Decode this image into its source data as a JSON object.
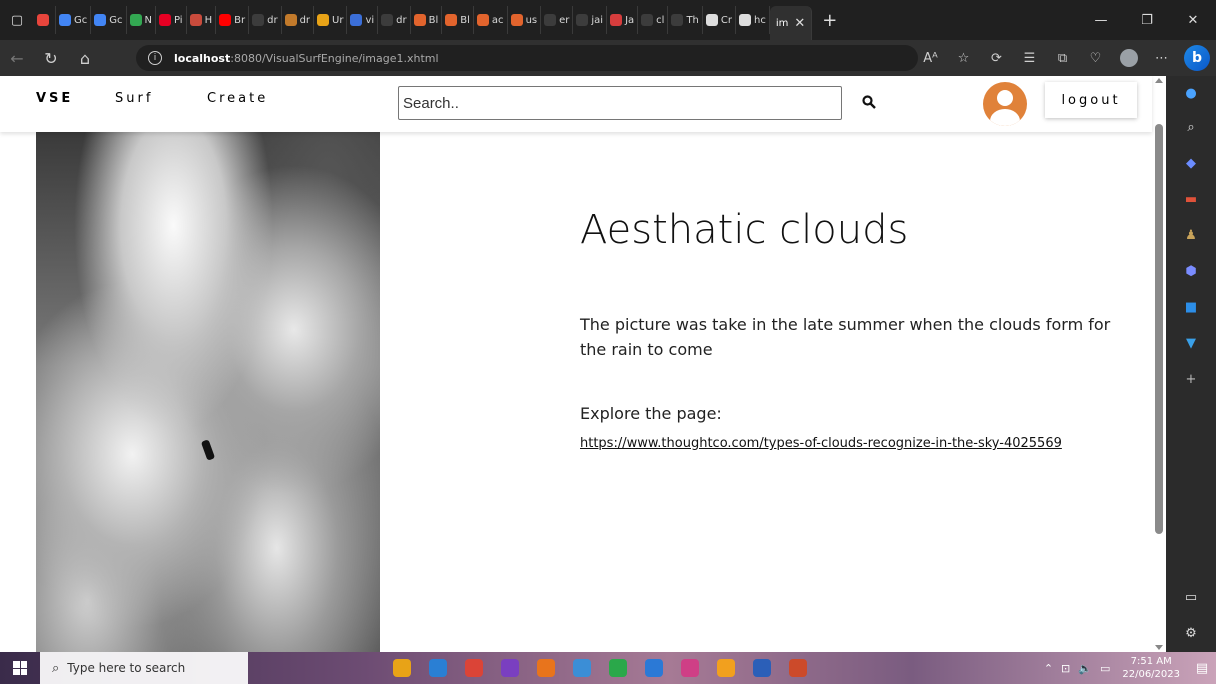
{
  "browser": {
    "tabs": [
      {
        "label": "",
        "color": "#e8453c"
      },
      {
        "label": "Gc",
        "color": "#4285f4"
      },
      {
        "label": "Gc",
        "color": "#4285f4"
      },
      {
        "label": "N",
        "color": "#33a852"
      },
      {
        "label": "Pi",
        "color": "#e60023"
      },
      {
        "label": "H",
        "color": "#c94b3c"
      },
      {
        "label": "Br",
        "color": "#ff0000"
      },
      {
        "label": "dr",
        "color": "#3c3c3c"
      },
      {
        "label": "dr",
        "color": "#c27a2b"
      },
      {
        "label": "Ur",
        "color": "#e8a317"
      },
      {
        "label": "vi",
        "color": "#3b6fd9"
      },
      {
        "label": "dr",
        "color": "#3c3c3c"
      },
      {
        "label": "Bl",
        "color": "#e2642d"
      },
      {
        "label": "Bl",
        "color": "#e2642d"
      },
      {
        "label": "ac",
        "color": "#e2642d"
      },
      {
        "label": "us",
        "color": "#e2642d"
      },
      {
        "label": "er",
        "color": "#3c3c3c"
      },
      {
        "label": "jai",
        "color": "#3c3c3c"
      },
      {
        "label": "Ja",
        "color": "#d63d3d"
      },
      {
        "label": "cl",
        "color": "#3c3c3c"
      },
      {
        "label": "Th",
        "color": "#3c3c3c"
      },
      {
        "label": "Cr",
        "color": "#dddddd"
      },
      {
        "label": "hc",
        "color": "#dddddd"
      }
    ],
    "active_tab_label": "im",
    "close_symbol": "✕",
    "new_tab_symbol": "+",
    "window_buttons": {
      "minimize": "—",
      "restore": "❐",
      "close": "✕"
    },
    "address": {
      "host": "localhost",
      "path": ":8080/VisualSurfEngine/image1.xhtml"
    },
    "read_aloud": "Aᴬ"
  },
  "site": {
    "brand": "VSE",
    "nav": {
      "surf": "Surf",
      "create": "Create"
    },
    "search_placeholder": "Search..",
    "logout_label": "logout",
    "accent_color": "#e0823a"
  },
  "post": {
    "title": "Aesthatic clouds",
    "description": "The picture was take in the late summer when the clouds form for the rain to come",
    "explore_label": "Explore the page:",
    "link": "https://www.thoughtco.com/types-of-clouds-recognize-in-the-sky-4025569"
  },
  "taskbar": {
    "search_placeholder": "Type here to search",
    "time": "7:51 AM",
    "date": "22/06/2023",
    "apps": [
      "#e8a317",
      "#2a7fd4",
      "#db4437",
      "#7a3fc0",
      "#e8741c",
      "#3b8ed6",
      "#2aa84a",
      "#2b79d6",
      "#cf3f86",
      "#f2a01e",
      "#2b5fb8",
      "#cc4a2a"
    ]
  }
}
